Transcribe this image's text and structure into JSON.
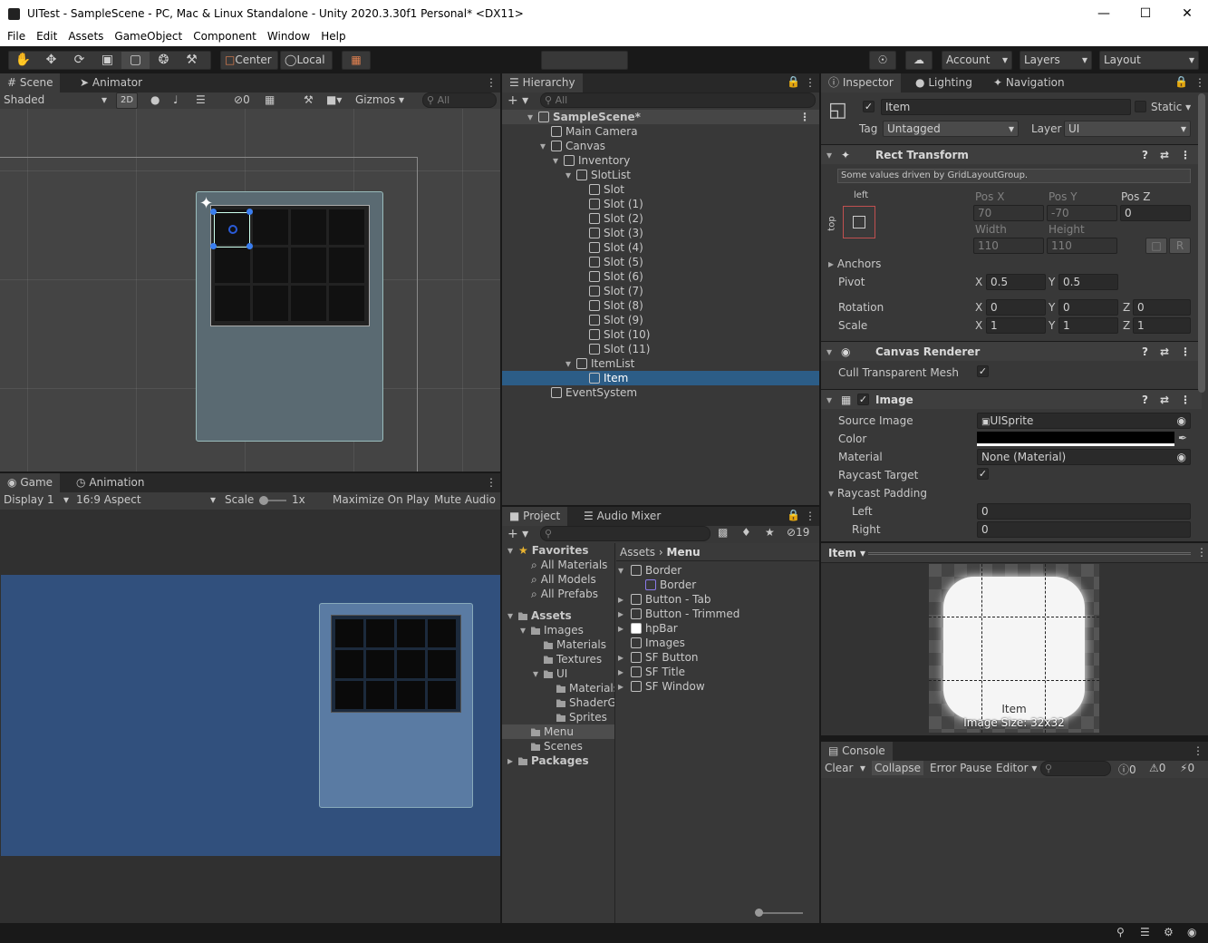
{
  "window": {
    "title": "UITest - SampleScene - PC, Mac & Linux Standalone - Unity 2020.3.30f1 Personal* <DX11>"
  },
  "menu": [
    "File",
    "Edit",
    "Assets",
    "GameObject",
    "Component",
    "Window",
    "Help"
  ],
  "toolbar": {
    "center": "Center",
    "local": "Local",
    "account": "Account",
    "layers": "Layers",
    "layout": "Layout"
  },
  "scene": {
    "tab": "Scene",
    "tab2": "Animator",
    "shading": "Shaded",
    "mode2d": "2D",
    "gizmos": "Gizmos",
    "search_placeholder": "All",
    "hidden_count": "0"
  },
  "game": {
    "tab": "Game",
    "tab2": "Animation",
    "display": "Display 1",
    "aspect": "16:9 Aspect",
    "scale_label": "Scale",
    "scale_value": "1x",
    "maximize": "Maximize On Play",
    "mute": "Mute Audio"
  },
  "hierarchy": {
    "tab": "Hierarchy",
    "search_placeholder": "All",
    "items": [
      {
        "label": "SampleScene*",
        "depth": 0
      },
      {
        "label": "Main Camera",
        "depth": 1
      },
      {
        "label": "Canvas",
        "depth": 1
      },
      {
        "label": "Inventory",
        "depth": 2
      },
      {
        "label": "SlotList",
        "depth": 3
      },
      {
        "label": "Slot",
        "depth": 4
      },
      {
        "label": "Slot (1)",
        "depth": 4
      },
      {
        "label": "Slot (2)",
        "depth": 4
      },
      {
        "label": "Slot (3)",
        "depth": 4
      },
      {
        "label": "Slot (4)",
        "depth": 4
      },
      {
        "label": "Slot (5)",
        "depth": 4
      },
      {
        "label": "Slot (6)",
        "depth": 4
      },
      {
        "label": "Slot (7)",
        "depth": 4
      },
      {
        "label": "Slot (8)",
        "depth": 4
      },
      {
        "label": "Slot (9)",
        "depth": 4
      },
      {
        "label": "Slot (10)",
        "depth": 4
      },
      {
        "label": "Slot (11)",
        "depth": 4
      },
      {
        "label": "ItemList",
        "depth": 3
      },
      {
        "label": "Item",
        "depth": 4
      },
      {
        "label": "EventSystem",
        "depth": 1
      }
    ],
    "selected": "Item"
  },
  "project": {
    "tab": "Project",
    "tab2": "Audio Mixer",
    "hidden_count": "19",
    "tree": [
      {
        "label": "Favorites",
        "depth": 0,
        "bold": true
      },
      {
        "label": "All Materials",
        "depth": 1
      },
      {
        "label": "All Models",
        "depth": 1
      },
      {
        "label": "All Prefabs",
        "depth": 1
      },
      {
        "label": "Assets",
        "depth": 0,
        "bold": true
      },
      {
        "label": "Images",
        "depth": 1
      },
      {
        "label": "Materials",
        "depth": 2
      },
      {
        "label": "Textures",
        "depth": 2
      },
      {
        "label": "UI",
        "depth": 2
      },
      {
        "label": "Materials",
        "depth": 3
      },
      {
        "label": "ShaderG",
        "depth": 3
      },
      {
        "label": "Sprites",
        "depth": 3
      },
      {
        "label": "Menu",
        "depth": 1
      },
      {
        "label": "Scenes",
        "depth": 1
      },
      {
        "label": "Packages",
        "depth": 0,
        "bold": true
      }
    ],
    "breadcrumb": [
      "Assets",
      "Menu"
    ],
    "files": [
      {
        "label": "Border",
        "depth": 0
      },
      {
        "label": "Border",
        "depth": 1
      },
      {
        "label": "Button - Tab",
        "depth": 0
      },
      {
        "label": "Button - Trimmed",
        "depth": 0
      },
      {
        "label": "hpBar",
        "depth": 0
      },
      {
        "label": "Images",
        "depth": 0
      },
      {
        "label": "SF Button",
        "depth": 0
      },
      {
        "label": "SF Title",
        "depth": 0
      },
      {
        "label": "SF Window",
        "depth": 0
      }
    ]
  },
  "inspector": {
    "tab": "Inspector",
    "tab2": "Lighting",
    "tab3": "Navigation",
    "name": "Item",
    "static": "Static",
    "tag_label": "Tag",
    "tag": "Untagged",
    "layer_label": "Layer",
    "layer": "UI",
    "rect": {
      "title": "Rect Transform",
      "note": "Some values driven by GridLayoutGroup.",
      "anchor_h": "left",
      "anchor_v": "top",
      "posx_label": "Pos X",
      "posy_label": "Pos Y",
      "posz_label": "Pos Z",
      "posx": "70",
      "posy": "-70",
      "posz": "0",
      "width_label": "Width",
      "height_label": "Height",
      "width": "110",
      "height": "110",
      "r": "R",
      "anchors": "Anchors",
      "pivot": "Pivot",
      "pivot_x": "0.5",
      "pivot_y": "0.5",
      "rotation": "Rotation",
      "rot_x": "0",
      "rot_y": "0",
      "rot_z": "0",
      "scale": "Scale",
      "scale_x": "1",
      "scale_y": "1",
      "scale_z": "1"
    },
    "canvas_renderer": {
      "title": "Canvas Renderer",
      "cull": "Cull Transparent Mesh"
    },
    "image": {
      "title": "Image",
      "source_label": "Source Image",
      "source": "UISprite",
      "color_label": "Color",
      "material_label": "Material",
      "material": "None (Material)",
      "raycast_label": "Raycast Target",
      "padding_label": "Raycast Padding",
      "left_label": "Left",
      "left": "0",
      "right_label": "Right",
      "right": "0"
    },
    "preview": {
      "label": "Item",
      "caption": "Item",
      "size": "Image Size: 32x32"
    }
  },
  "console": {
    "tab": "Console",
    "clear": "Clear",
    "collapse": "Collapse",
    "error_pause": "Error Pause",
    "editor": "Editor",
    "info": "0",
    "warn": "0",
    "err": "0"
  }
}
